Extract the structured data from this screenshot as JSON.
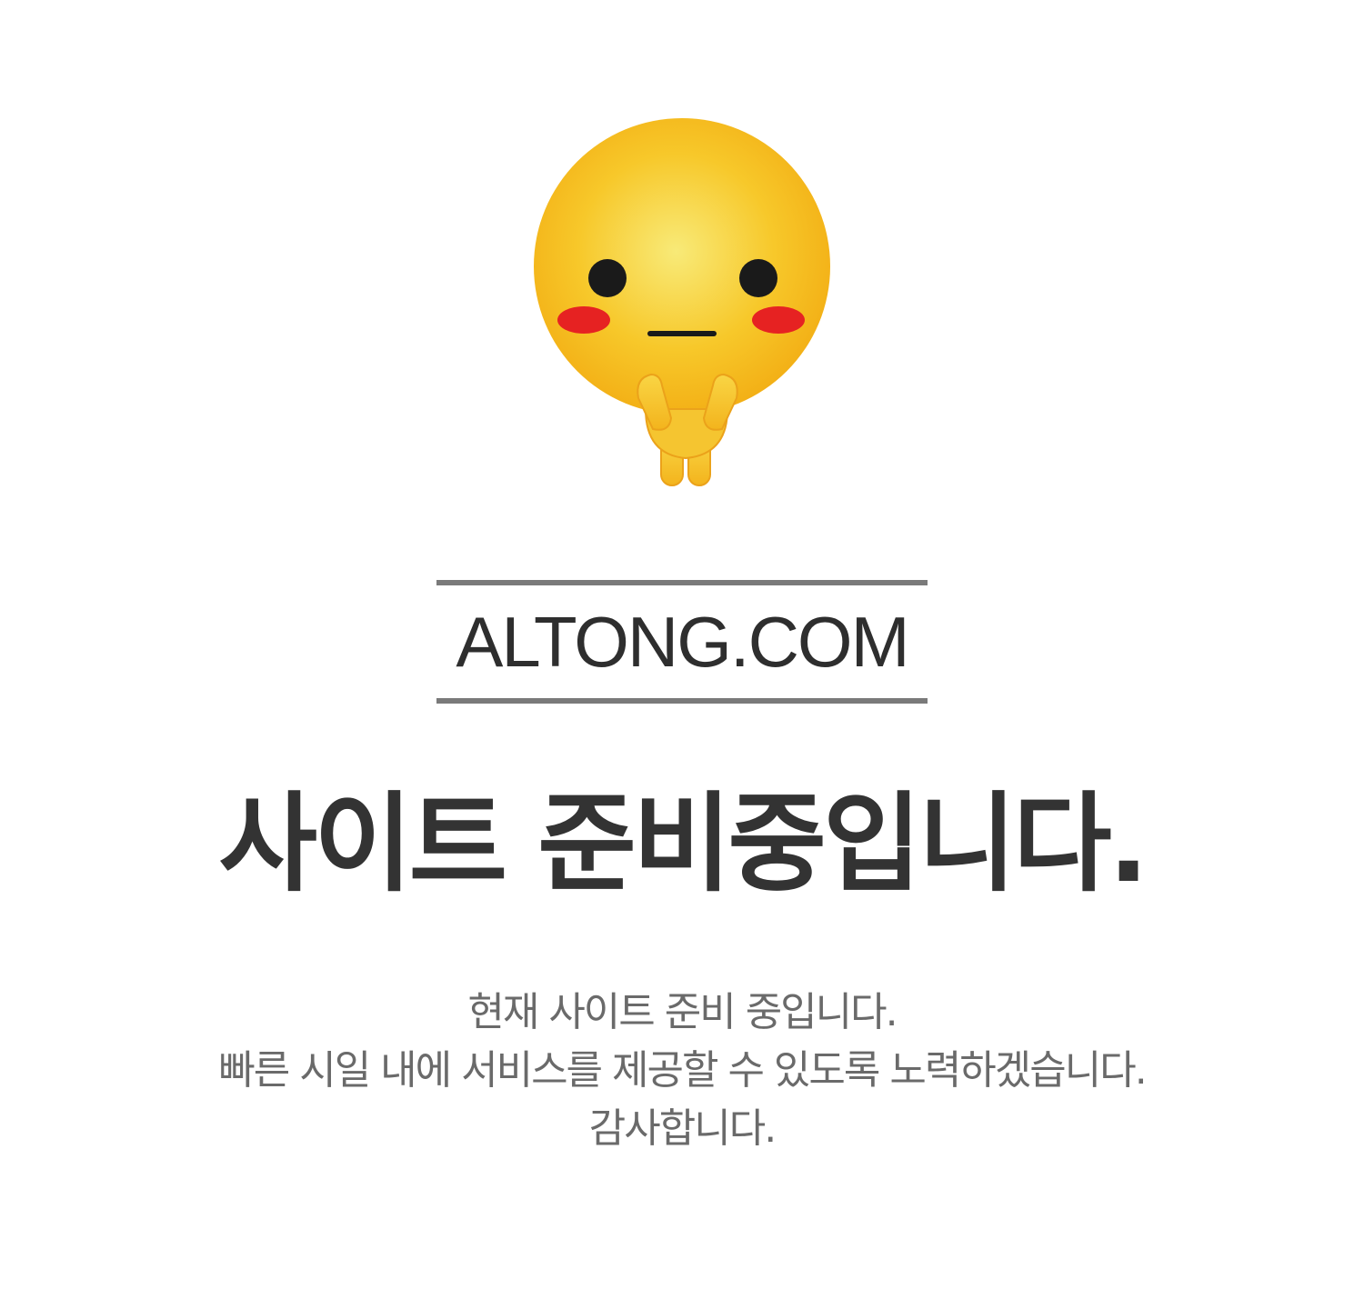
{
  "mascot": {
    "icon": "smiley-mascot-icon",
    "colors": {
      "face": "#f7c21a",
      "cheeks": "#e62222",
      "eyes": "#1a1a1a"
    }
  },
  "brand": {
    "name": "ALTONG.COM",
    "rule_color": "#7a7a7a"
  },
  "headline": "사이트 준비중입니다.",
  "message": {
    "lines": [
      "현재 사이트 준비 중입니다.",
      "빠른 시일 내에 서비스를 제공할 수 있도록 노력하겠습니다.",
      "감사합니다."
    ]
  }
}
